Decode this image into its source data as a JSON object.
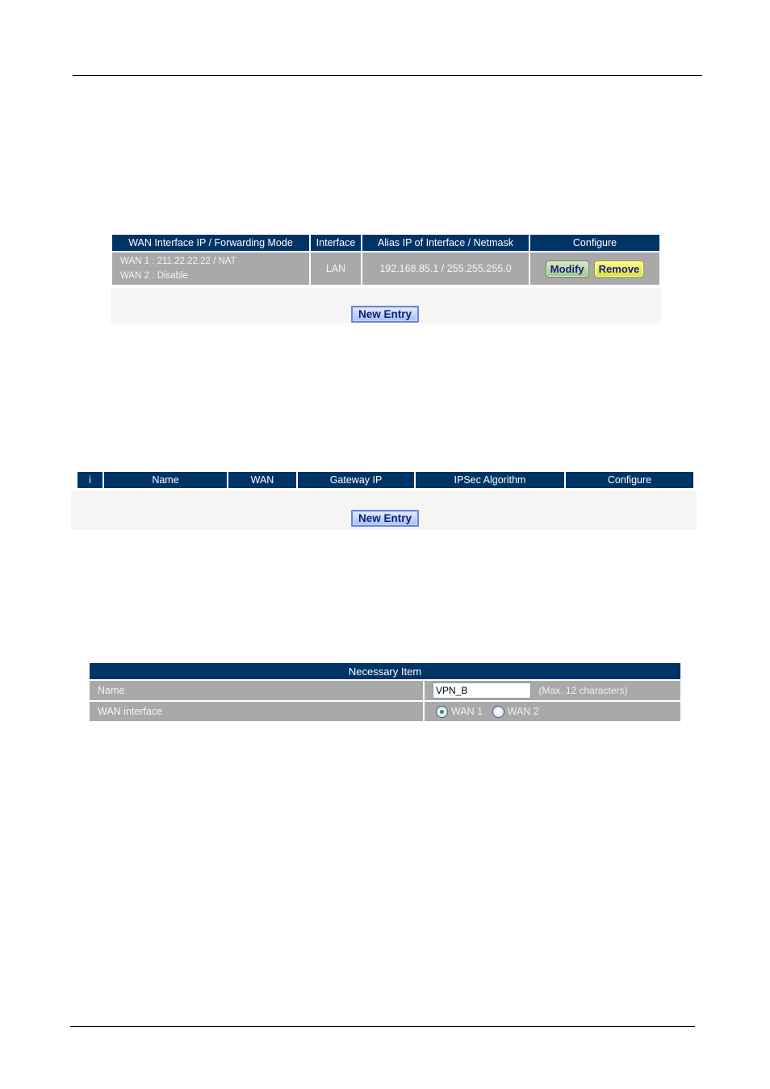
{
  "table_alias": {
    "headers": [
      "WAN Interface IP / Forwarding Mode",
      "Interface",
      "Alias IP of Interface / Netmask",
      "Configure"
    ],
    "rows": [
      {
        "wan_lines": [
          "WAN 1 : 211.22.22.22 / NAT",
          "WAN 2 : Disable"
        ],
        "interface": "LAN",
        "alias_ip": "192.168.85.1 / 255.255.255.0",
        "modify_label": "Modify",
        "remove_label": "Remove"
      }
    ],
    "new_entry_label": "New Entry"
  },
  "table_vpn": {
    "headers": [
      "i",
      "Name",
      "WAN",
      "Gateway IP",
      "IPSec Algorithm",
      "Configure"
    ],
    "new_entry_label": "New Entry"
  },
  "form": {
    "section_title": "Necessary Item",
    "name_label": "Name",
    "name_value": "VPN_B",
    "name_hint": "(Max. 12 characters)",
    "wan_label": "WAN interface",
    "wan_options": [
      {
        "label": "WAN 1",
        "checked": true
      },
      {
        "label": "WAN 2",
        "checked": false
      }
    ]
  },
  "colors": {
    "header_bg": "#003366",
    "cell_bg": "#a9a9a9",
    "modify_btn": "#9fc789",
    "remove_btn": "#e0df3a",
    "new_entry_btn": "#a8bff5"
  }
}
